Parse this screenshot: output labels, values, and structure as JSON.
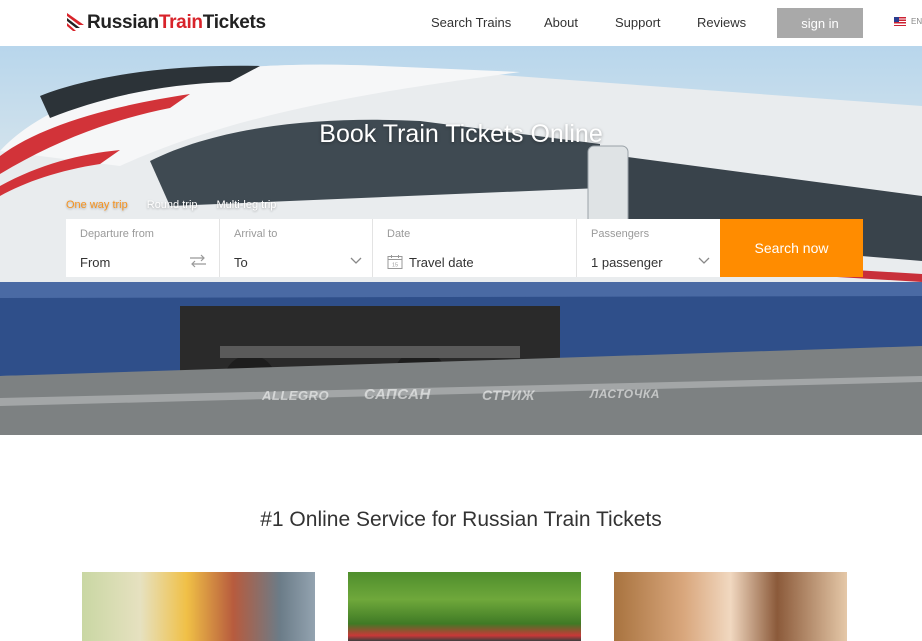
{
  "header": {
    "logo": {
      "part1": "Russian",
      "part2": "Train",
      "part3": "Tickets"
    },
    "nav": [
      "Search Trains",
      "About",
      "Support",
      "Reviews"
    ],
    "signin_label": "sign in",
    "lang_label": "EN"
  },
  "hero": {
    "title": "Book Train Tickets Online",
    "tabs": [
      "One way trip",
      "Round trip",
      "Multi-leg trip"
    ],
    "form": {
      "departure": {
        "label": "Departure from",
        "value": "From"
      },
      "arrival": {
        "label": "Arrival to",
        "value": "To"
      },
      "date": {
        "label": "Date",
        "value": "Travel date"
      },
      "passengers": {
        "label": "Passengers",
        "value": "1 passenger"
      },
      "search_label": "Search now"
    },
    "brands": [
      "ALLEGRO",
      "САПСАН",
      "СТРИЖ",
      "ЛАСТОЧКА"
    ]
  },
  "section": {
    "title": "#1 Online Service for Russian Train Tickets"
  },
  "colors": {
    "accent": "#ff8c00",
    "active_tab": "#f79420",
    "brand_red": "#d8232a",
    "signin_bg": "#a9a9a9"
  }
}
